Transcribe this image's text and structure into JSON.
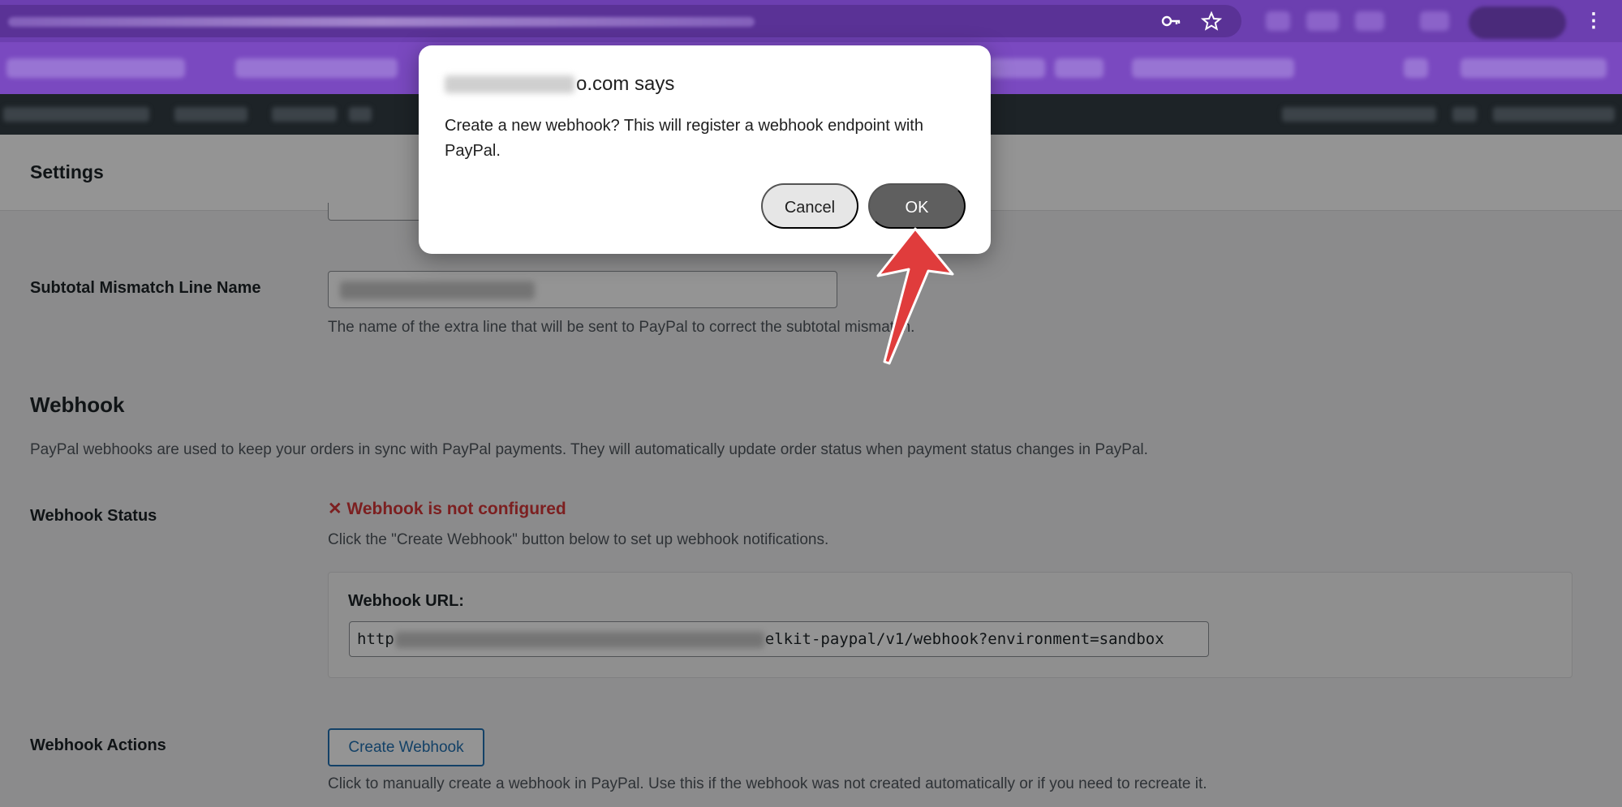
{
  "dialog": {
    "title_suffix": "o.com says",
    "message": "Create a new webhook? This will register a webhook endpoint with PayPal.",
    "cancel_label": "Cancel",
    "ok_label": "OK"
  },
  "settings": {
    "title": "Settings"
  },
  "subtotal_field": {
    "label": "Subtotal Mismatch Line Name",
    "description": "The name of the extra line that will be sent to PayPal to correct the subtotal mismatch."
  },
  "webhook": {
    "section_title": "Webhook",
    "section_description": "PayPal webhooks are used to keep your orders in sync with PayPal payments. They will automatically update order status when payment status changes in PayPal.",
    "status_label": "Webhook Status",
    "status_text": "✕ Webhook is not configured",
    "status_hint": "Click the \"Create Webhook\" button below to set up webhook notifications.",
    "url_label": "Webhook URL:",
    "url_prefix": "http",
    "url_suffix": "elkit-paypal/v1/webhook?environment=sandbox",
    "actions_label": "Webhook Actions",
    "create_button": "Create Webhook",
    "actions_hint": "Click to manually create a webhook in PayPal. Use this if the webhook was not created automatically or if you need to recreate it."
  },
  "browser": {
    "key_icon": "key-icon",
    "star_icon": "star-icon",
    "menu_icon": "menu-dots-icon"
  },
  "colors": {
    "error": "#d63638",
    "primary": "#2271b1",
    "chrome": "#6c3fb0",
    "annotation_arrow": "#e03c3c"
  }
}
